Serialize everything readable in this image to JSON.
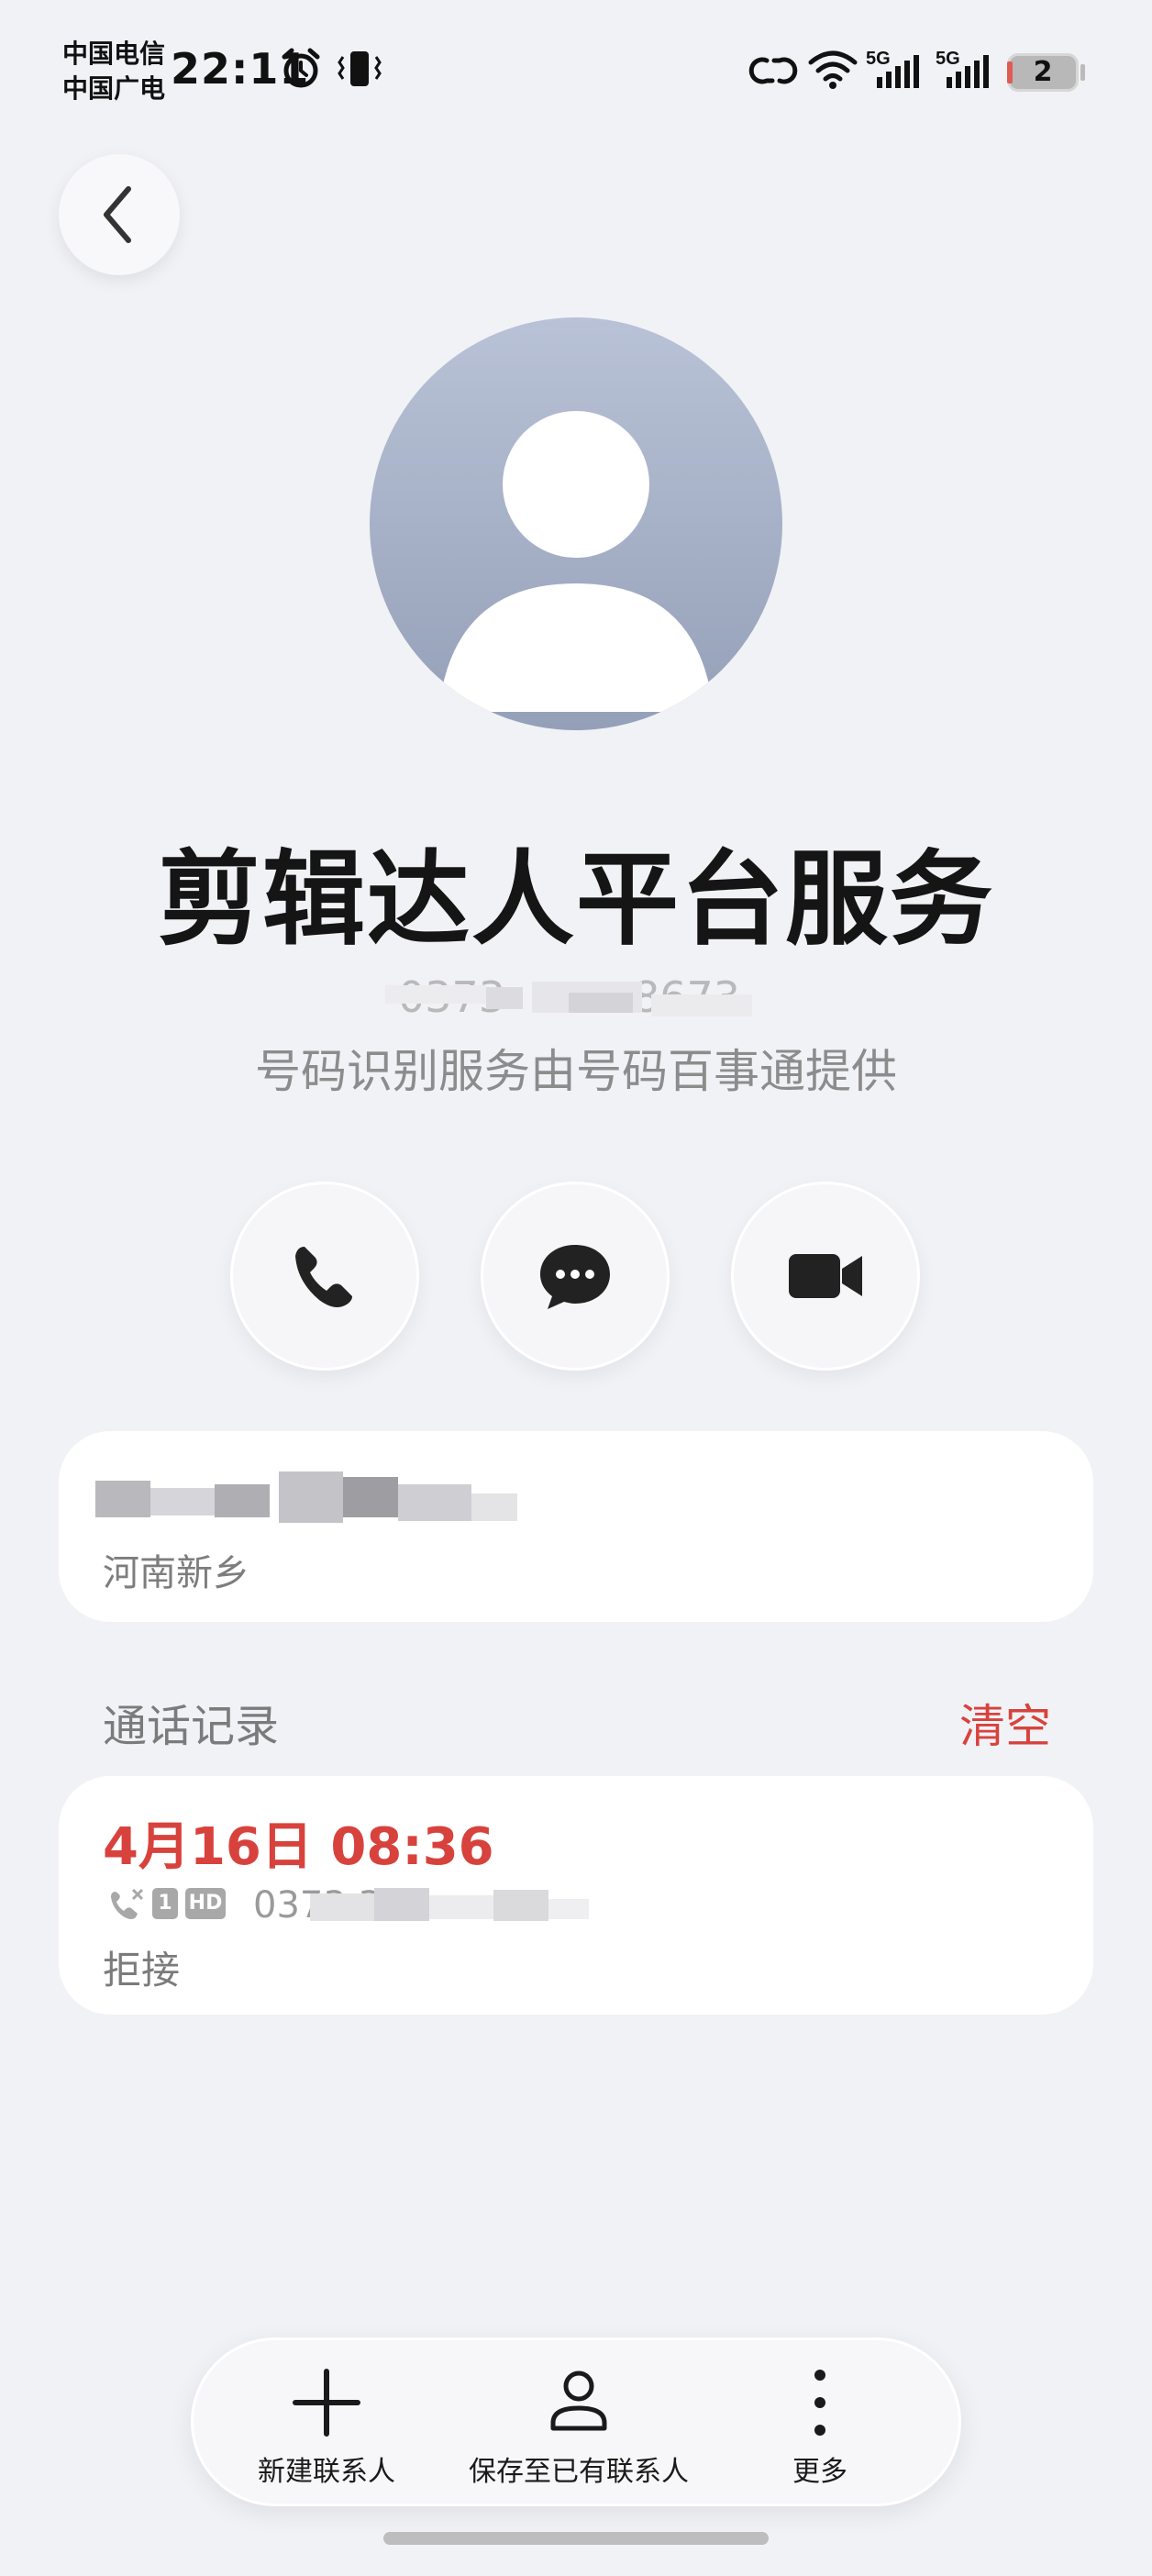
{
  "status_bar": {
    "carrier_1": "中国电信",
    "carrier_2": "中国广电",
    "time": "22:11",
    "network_1": "5G",
    "network_2": "5G",
    "battery": "2"
  },
  "contact": {
    "name": "剪辑达人平台服务",
    "number_partial_1": "0373",
    "number_partial_2": "8673",
    "provider_note": "号码识别服务由号码百事通提供"
  },
  "actions": {
    "call": "phone-icon",
    "message": "message-icon",
    "video": "video-icon"
  },
  "number_card": {
    "location": "河南新乡"
  },
  "call_log": {
    "title": "通话记录",
    "clear_label": "清空",
    "entries": [
      {
        "time": "4月16日 08:36",
        "sim": "1",
        "hd": "HD",
        "number_partial": "0373 35",
        "status": "拒接"
      }
    ]
  },
  "bottom_bar": {
    "new_contact": "新建联系人",
    "save_existing": "保存至已有联系人",
    "more": "更多"
  },
  "colors": {
    "accent_red": "#d8423c",
    "background": "#f1f2f6"
  }
}
